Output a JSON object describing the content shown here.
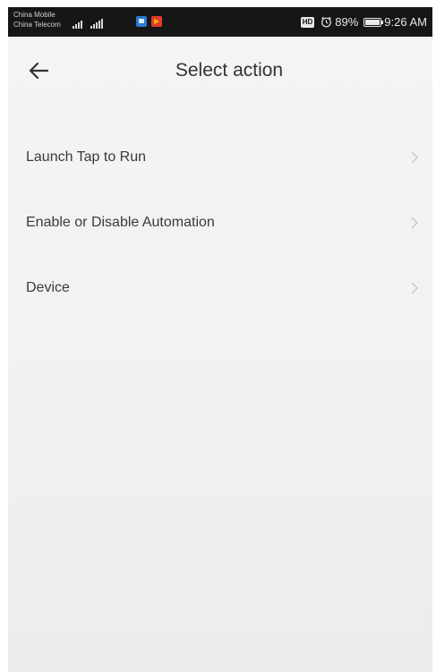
{
  "status_bar": {
    "carrier_1": "China Mobile",
    "carrier_2": "China Telecom",
    "hd_label": "HD",
    "battery": "89%",
    "time": "9:26 AM"
  },
  "header": {
    "title": "Select action",
    "back_icon": "arrow-left-icon"
  },
  "actions": [
    {
      "label": "Launch Tap to Run",
      "icon": "chevron-right-icon"
    },
    {
      "label": "Enable or Disable Automation",
      "icon": "chevron-right-icon"
    },
    {
      "label": "Device",
      "icon": "chevron-right-icon"
    }
  ],
  "colors": {
    "status_bar_bg": "#161616",
    "page_bg": "#f4f4f4",
    "text_primary": "#333333",
    "chevron": "#c4c4c4"
  }
}
